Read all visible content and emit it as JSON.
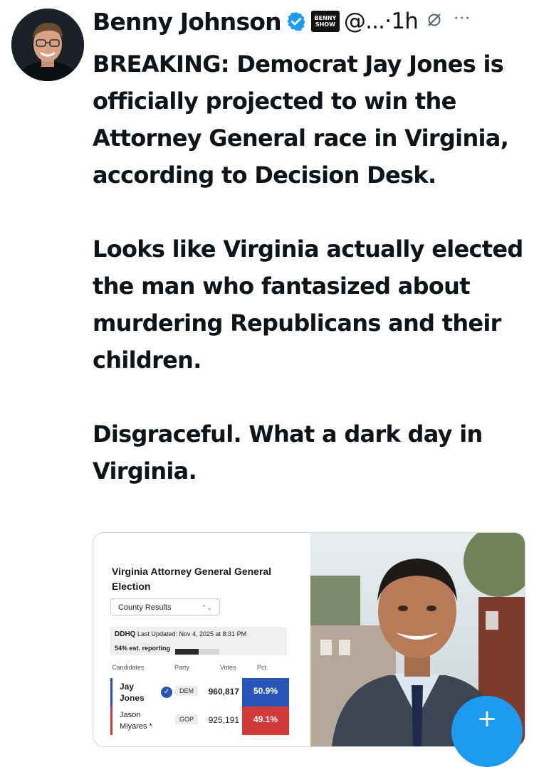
{
  "post": {
    "author_name": "Benny Johnson",
    "handle": "@...",
    "separator": "·",
    "time": "1h",
    "affiliate_badge_lines": [
      "BENNY",
      "SHOW"
    ],
    "grok_icon": "grok-icon",
    "more_icon_text": "···",
    "paragraphs": [
      "BREAKING: Democrat Jay Jones is officially projected to win the Attorney General race in Virginia, according to Decision Desk.",
      "Looks like Virginia actually elected the man who fantasized about murdering Republicans and their children.",
      "Disgraceful. What a dark day in Virginia."
    ]
  },
  "card": {
    "title": "Virginia Attorney General General Election",
    "select_value": "County Results",
    "status_logo": "DDHQ",
    "last_updated": "Last Updated: Nov 4, 2025 at 8:31 PM",
    "reporting_label": "54% est. reporting",
    "reporting_fraction": 0.54,
    "headers": {
      "candidates": "Candidates",
      "party": "Party",
      "votes": "Votes",
      "pct": "Pct."
    },
    "rows": [
      {
        "candidate": "Jay Jones",
        "party": "DEM",
        "votes": "960,817",
        "pct": "50.9%",
        "winner": true
      },
      {
        "candidate": "Jason Miyares *",
        "party": "GOP",
        "votes": "925,191",
        "pct": "49.1%",
        "winner": false
      }
    ]
  },
  "colors": {
    "verified_blue": "#1d9bf0",
    "dem_blue": "#2a55b8",
    "gop_red": "#d23a3a",
    "fab_blue": "#1d9bf0"
  }
}
